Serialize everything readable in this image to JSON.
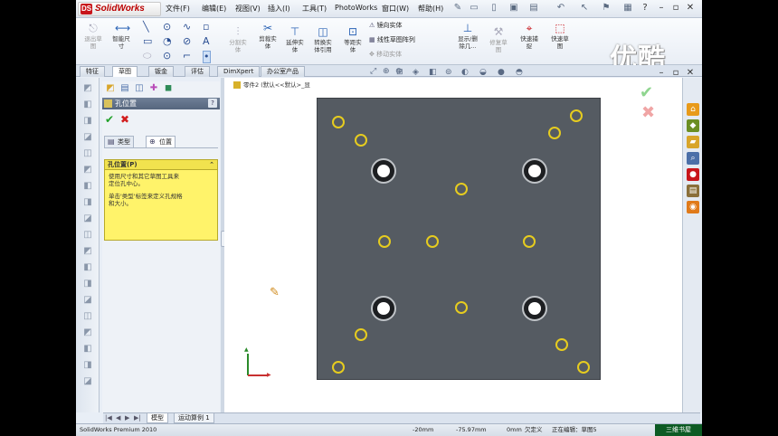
{
  "app": {
    "name": "SolidWorks",
    "brand_color": "#c8151b"
  },
  "menus": [
    "文件(F)",
    "编辑(E)",
    "视图(V)",
    "插入(I)",
    "工具(T)",
    "PhotoWorks",
    "窗口(W)",
    "帮助(H)"
  ],
  "toolbar": {
    "tools": [
      {
        "label": "退出草\n图",
        "icon": "exit-sketch-icon"
      },
      {
        "label": "智能尺\n寸",
        "icon": "smart-dimension-icon"
      },
      {
        "label": "分割实\n体",
        "icon": "split-entities-icon"
      },
      {
        "label": "剪裁实\n体",
        "icon": "trim-entities-icon"
      },
      {
        "label": "延伸实\n体",
        "icon": "extend-entities-icon"
      },
      {
        "label": "转换实\n体引用",
        "icon": "convert-entities-icon"
      },
      {
        "label": "等距实\n体",
        "icon": "offset-entities-icon"
      },
      {
        "label": "镜向实体",
        "icon": "mirror-entities-icon"
      },
      {
        "label": "线性草图阵列",
        "icon": "linear-pattern-icon"
      },
      {
        "label": "移动实体",
        "icon": "move-entities-icon"
      },
      {
        "label": "显示/删\n除几...",
        "icon": "display-relations-icon"
      },
      {
        "label": "修复草\n图",
        "icon": "repair-sketch-icon"
      },
      {
        "label": "快速捕\n捉",
        "icon": "quick-snaps-icon"
      },
      {
        "label": "快速草\n图",
        "icon": "rapid-sketch-icon"
      }
    ]
  },
  "watermark": "优酷",
  "tabs": [
    "特征",
    "草图",
    "钣金",
    "评估",
    "DimXpert",
    "办公室产品"
  ],
  "active_tab": "草图",
  "tree_label": "零件2  (默认<<默认>_显",
  "property_manager": {
    "title": "孔位置",
    "help": "?",
    "sub_tabs": [
      "类型",
      "位置"
    ],
    "active_sub_tab": "位置",
    "group_title": "孔位置(P)",
    "message_1": "使用尺寸和其它草图工具来\n定位孔中心。",
    "message_2": "单击'类型'标签来定义孔规格\n和大小。"
  },
  "bottom_tabs": [
    "模型",
    "运动算例 1"
  ],
  "active_bottom_tab": "模型",
  "status": {
    "product": "SolidWorks Premium 2010",
    "x": "-20mm",
    "y": "-75.97mm",
    "z": "0mm",
    "state": "欠定义",
    "editing": "正在编辑：草图5"
  },
  "corner_label": "三维书屋"
}
